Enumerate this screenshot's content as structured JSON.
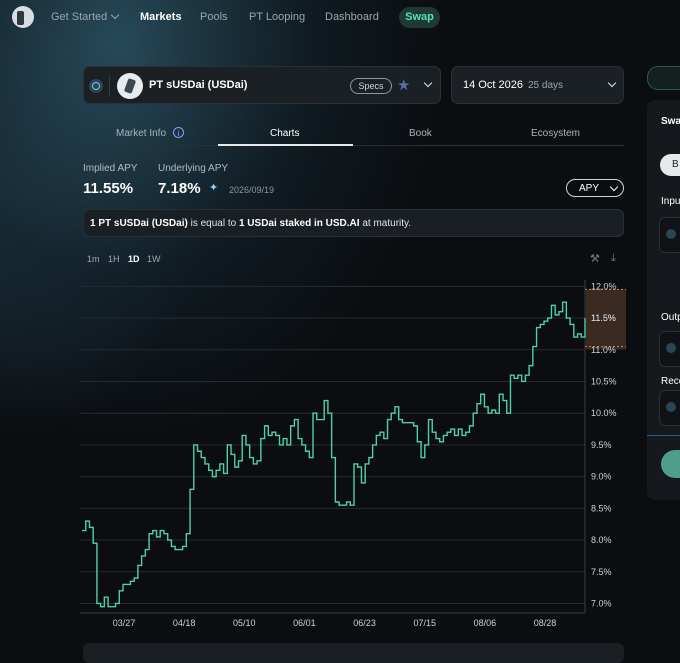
{
  "nav": {
    "items": [
      {
        "label": "Get Started",
        "dropdown": true
      },
      {
        "label": "Markets",
        "active": true
      },
      {
        "label": "Pools"
      },
      {
        "label": "PT Looping"
      },
      {
        "label": "Dashboard"
      },
      {
        "label": "Swap",
        "highlight": true
      }
    ]
  },
  "market": {
    "name": "PT sUSDai (USDai)",
    "specs_label": "Specs",
    "maturity_date": "14 Oct 2026",
    "days_left": "25 days"
  },
  "tabs": [
    "Market Info",
    "Charts",
    "Book",
    "Ecosystem"
  ],
  "active_tab": "Charts",
  "apy": {
    "implied_label": "Implied APY",
    "implied_value": "11.55%",
    "underlying_label": "Underlying APY",
    "underlying_value": "7.18%",
    "underlying_date": "2026/09/19",
    "selector": "APY"
  },
  "notice": {
    "part1": "1 PT sUSDai (USDai)",
    "part2": " is equal to ",
    "part3": "1 USDai staked in USD.AI",
    "part4": " at maturity."
  },
  "timeframes": [
    "1m",
    "1H",
    "1D",
    "1W"
  ],
  "active_timeframe": "1D",
  "icons": {
    "settings": "wrench-icon",
    "download": "download-icon",
    "favorite": "star-icon"
  },
  "colors": {
    "line": "#4fd1a5",
    "accent": "#56e0b6",
    "current_label_bg": "#3a2a22"
  },
  "right_panel": {
    "title_fragment": "Swa",
    "chip_fragment": "B",
    "input_fragment": "Inpu",
    "output_fragment": "Outp",
    "receive_fragment": "Reco"
  },
  "chart_data": {
    "type": "line",
    "title": "",
    "xlabel": "",
    "ylabel": "",
    "x_ticks": [
      "03/27",
      "04/18",
      "05/10",
      "06/01",
      "06/23",
      "07/15",
      "08/06",
      "08/28"
    ],
    "y_ticks": [
      "7.0%",
      "7.5%",
      "8.0%",
      "8.5%",
      "9.0%",
      "9.5%",
      "10.0%",
      "10.5%",
      "11.0%",
      "11.5%",
      "12.0%"
    ],
    "ylim": [
      6.85,
      12.1
    ],
    "current_value_label": "11.5%",
    "grid": "horizontal",
    "series": [
      {
        "values": [
          8.15,
          8.3,
          8.2,
          7.95,
          7.0,
          6.95,
          7.1,
          6.95,
          6.95,
          7.0,
          7.2,
          7.3,
          7.3,
          7.35,
          7.4,
          7.6,
          7.75,
          7.85,
          8.1,
          8.15,
          8.05,
          8.15,
          8.1,
          8.0,
          7.9,
          7.85,
          7.85,
          7.9,
          8.1,
          8.8,
          9.5,
          9.4,
          9.3,
          9.2,
          9.1,
          9.0,
          9.1,
          9.2,
          9.05,
          9.5,
          9.35,
          9.15,
          9.25,
          9.65,
          9.5,
          9.3,
          9.2,
          9.25,
          9.6,
          9.8,
          9.65,
          9.7,
          9.65,
          9.5,
          9.6,
          9.5,
          9.8,
          9.9,
          9.6,
          9.5,
          9.4,
          9.3,
          10.0,
          9.9,
          9.9,
          10.2,
          10.0,
          9.3,
          8.6,
          8.55,
          8.55,
          8.6,
          8.55,
          9.2,
          9.15,
          8.9,
          9.2,
          9.3,
          9.5,
          9.65,
          9.7,
          9.6,
          9.9,
          10.0,
          10.1,
          9.9,
          9.85,
          9.85,
          9.85,
          9.8,
          9.55,
          9.3,
          9.5,
          9.9,
          9.7,
          9.6,
          9.55,
          9.65,
          9.7,
          9.75,
          9.65,
          9.75,
          9.65,
          9.7,
          9.8,
          10.0,
          10.15,
          10.3,
          10.1,
          10.0,
          10.05,
          10.0,
          10.3,
          10.2,
          10.0,
          10.6,
          10.55,
          10.6,
          10.5,
          10.6,
          10.75,
          11.05,
          11.35,
          11.4,
          11.45,
          11.5,
          11.7,
          11.55,
          11.6,
          11.75,
          11.5,
          11.4,
          11.2,
          11.25,
          11.2,
          11.5
        ]
      }
    ]
  }
}
